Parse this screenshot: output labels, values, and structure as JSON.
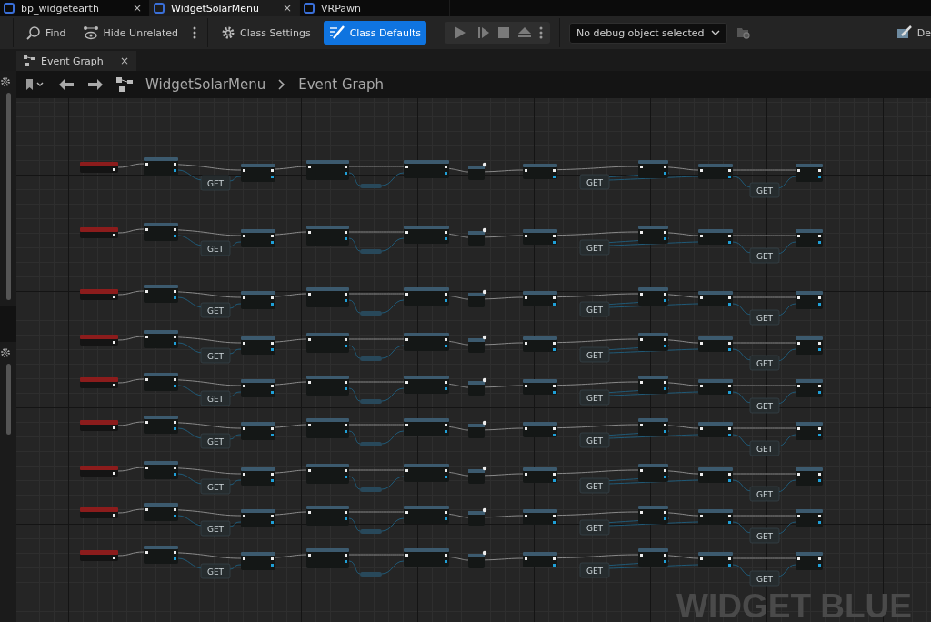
{
  "editor_tabs": [
    {
      "label": "bp_widgetearth",
      "selected": false,
      "close": "×"
    },
    {
      "label": "WidgetSolarMenu",
      "selected": true,
      "close": "×"
    },
    {
      "label": "VRPawn",
      "selected": false
    }
  ],
  "toolbar": {
    "find": "Find",
    "hide_unrelated": "Hide Unrelated",
    "class_settings": "Class Settings",
    "class_defaults": "Class Defaults",
    "debug_object": "No debug object selected",
    "cut_button": "De"
  },
  "graph_tab": {
    "label": "Event Graph",
    "close": "×"
  },
  "breadcrumb": [
    "WidgetSolarMenu",
    "Event Graph"
  ],
  "graph": {
    "watermark": "WIDGET BLUE",
    "rows": [
      {
        "get_labels": [
          "GET",
          "GET",
          "GET"
        ]
      },
      {
        "get_labels": [
          "GET",
          "GET",
          "GET"
        ]
      },
      {
        "get_labels": [
          "GET",
          "GET",
          "GET"
        ]
      },
      {
        "get_labels": [
          "GET",
          "GET",
          "GET"
        ]
      },
      {
        "get_labels": [
          "GET",
          "GET",
          "GET"
        ]
      },
      {
        "get_labels": [
          "GET",
          "GET",
          "GET"
        ]
      },
      {
        "get_labels": [
          "GET",
          "GET",
          "GET"
        ]
      },
      {
        "get_labels": [
          "GET",
          "GET",
          "GET"
        ]
      },
      {
        "get_labels": [
          "GET",
          "GET",
          "GET"
        ]
      }
    ]
  }
}
